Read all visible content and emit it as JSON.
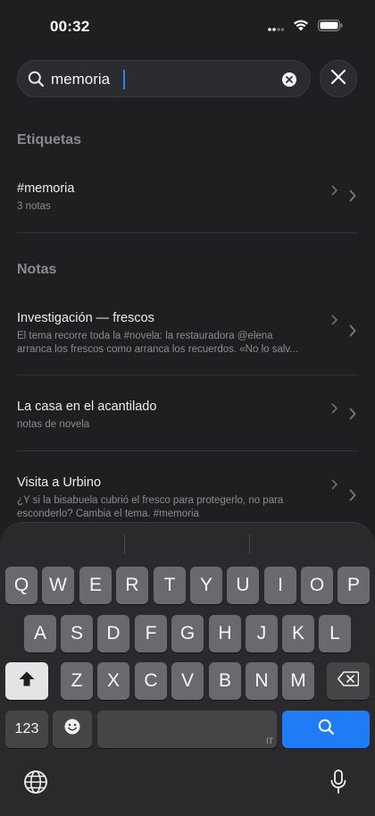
{
  "status": {
    "time": "00:32"
  },
  "search": {
    "value": "memoria"
  },
  "sections": {
    "tags_header": "Etiquetas",
    "notes_header": "Notas"
  },
  "tags": [
    {
      "title": "#memoria",
      "subtitle": "3 notas"
    }
  ],
  "notes": [
    {
      "title": "Investigación — frescos",
      "line1": "El tema recorre toda la #novela: la restauradora @elena",
      "line2": "arranca los frescos como arranca los recuerdos. «No lo salv..."
    },
    {
      "title": "La casa en el acantilado",
      "line1": "notas de novela"
    },
    {
      "title": "Visita a Urbino",
      "line1": "¿Y si la bisabuela cubrió el fresco para protegerlo, no para",
      "line2": "esconderlo? Cambia el tema. #memoria"
    }
  ],
  "keyboard": {
    "row1": [
      "Q",
      "W",
      "E",
      "R",
      "T",
      "Y",
      "U",
      "I",
      "O",
      "P"
    ],
    "row2": [
      "A",
      "S",
      "D",
      "F",
      "G",
      "H",
      "J",
      "K",
      "L"
    ],
    "row3": [
      "Z",
      "X",
      "C",
      "V",
      "B",
      "N",
      "M"
    ],
    "numbers_label": "123",
    "space_lang": "IT"
  },
  "colors": {
    "accent": "#1f7cf6",
    "background": "#1f1f21"
  }
}
